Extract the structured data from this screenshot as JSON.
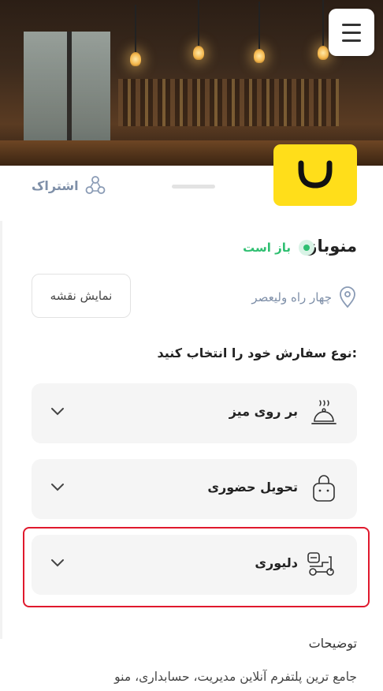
{
  "header": {
    "cover_image": "cafe-interior-photo",
    "menu_icon": "hamburger-menu-icon",
    "logo_icon": "store-logo-icon",
    "logo_color": "#ffde1a"
  },
  "share": {
    "label": "اشتراک",
    "icon": "share-icon"
  },
  "store": {
    "name": "منوباز",
    "status": "باز است",
    "status_color": "#2fbf71",
    "address": "چهار راه ولیعصر",
    "map_button": "نمایش نقشه"
  },
  "order": {
    "heading": "نوع سفارش خود را انتخاب کنید:",
    "options": [
      {
        "label": "بر روی میز",
        "icon": "food-cloche-icon"
      },
      {
        "label": "تحویل حضوری",
        "icon": "shopping-bag-icon"
      },
      {
        "label": "دلیوری",
        "icon": "delivery-scooter-icon"
      }
    ]
  },
  "description": {
    "heading": "توضیحات",
    "text": "جامع ترین پلتفرم آنلاین مدیریت، حسابداری، منو"
  },
  "highlight_color": "#e0192d"
}
